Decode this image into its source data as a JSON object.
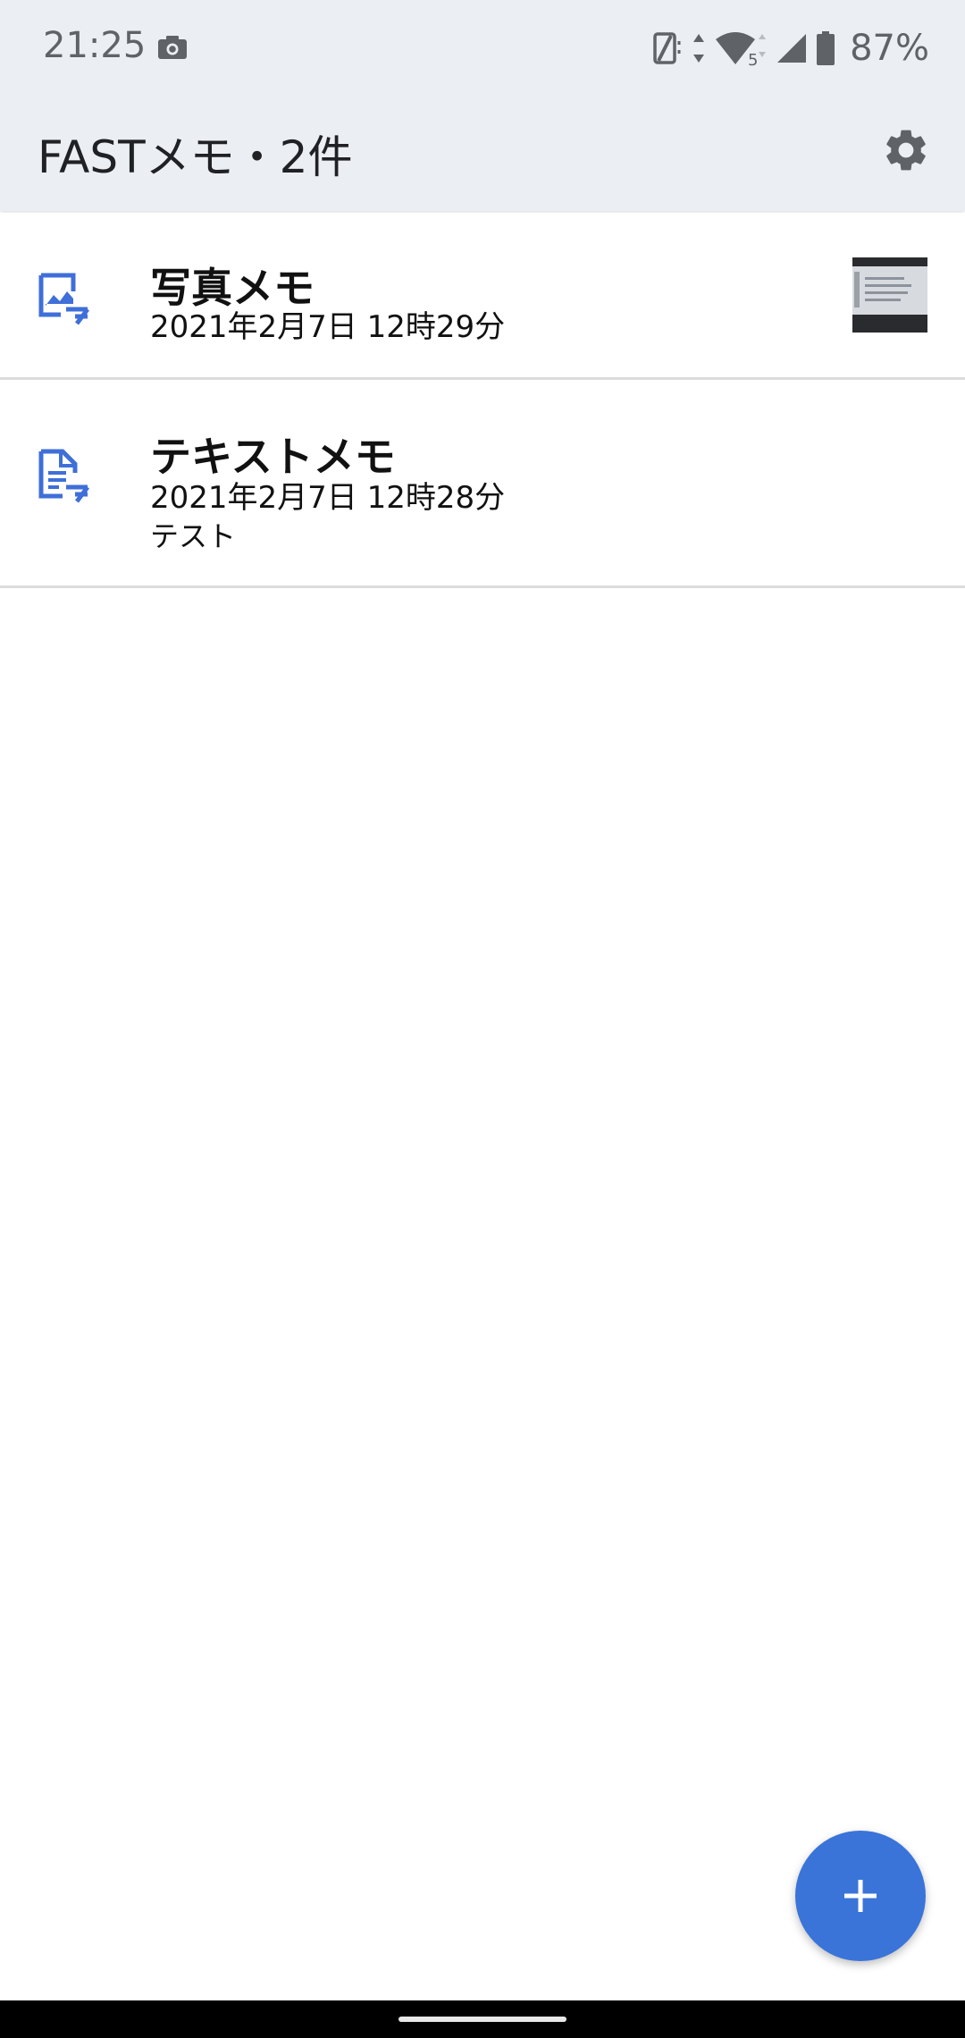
{
  "status_bar": {
    "time": "21:25",
    "battery_percent": "87%",
    "network_label": "5",
    "icons": [
      "camera-icon",
      "vibrate-icon",
      "data-arrows-icon",
      "wifi-icon",
      "signal-icon",
      "battery-icon"
    ]
  },
  "app_bar": {
    "title": "FASTメモ・2件",
    "settings_icon": "gear-icon"
  },
  "memos": [
    {
      "type": "photo",
      "icon": "image-note-icon",
      "title": "写真メモ",
      "date": "2021年2月7日 12時29分",
      "body": ""
    },
    {
      "type": "text",
      "icon": "text-note-icon",
      "title": "テキストメモ",
      "date": "2021年2月7日 12時28分",
      "body": "テスト"
    }
  ],
  "fab": {
    "icon": "plus-icon"
  },
  "colors": {
    "accent": "#3a74d9",
    "icon_blue": "#3f6fd8",
    "topbar_bg": "#ebeef2",
    "divider": "#dcdcdc"
  }
}
